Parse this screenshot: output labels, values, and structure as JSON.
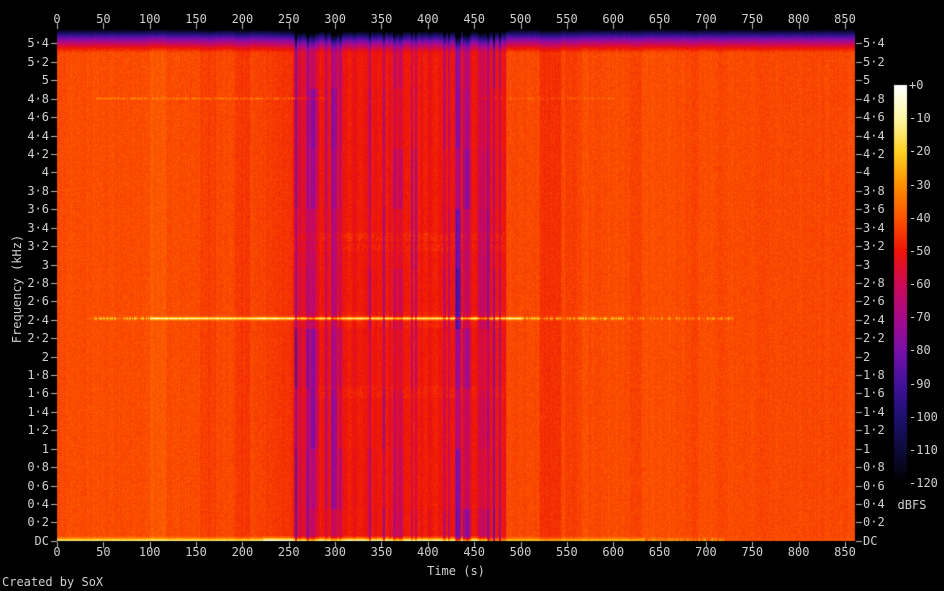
{
  "credit": "Created by SoX",
  "colors": {
    "background": "#000000",
    "label_text": "#cfcfcf",
    "tick_mark": "#b8b8b8"
  },
  "chart_data": {
    "type": "heatmap",
    "subtype": "audio-spectrogram",
    "title": "",
    "xlabel": "Time (s)",
    "ylabel": "Frequency (kHz)",
    "colorbar_label": "dBFS",
    "x_tick_labels": [
      "0",
      "50",
      "100",
      "150",
      "200",
      "250",
      "300",
      "350",
      "400",
      "450",
      "500",
      "550",
      "600",
      "650",
      "700",
      "750",
      "800",
      "850"
    ],
    "x_tick_step_s": 50,
    "freq_tick_labels": [
      "5·4",
      "5·2",
      "5",
      "4·8",
      "4·6",
      "4·4",
      "4·2",
      "4",
      "3·8",
      "3·6",
      "3·4",
      "3·2",
      "3",
      "2·8",
      "2·6",
      "2·4",
      "2·2",
      "2",
      "1·8",
      "1·6",
      "1·4",
      "1·2",
      "1",
      "0·8",
      "0·6",
      "0·4",
      "0·2",
      "DC"
    ],
    "freq_tick_step_khz": 0.2,
    "db_tick_labels": [
      "+0",
      "-10",
      "-20",
      "-30",
      "-40",
      "-50",
      "-60",
      "-70",
      "-80",
      "-90",
      "-100",
      "-110",
      "-120"
    ],
    "x_range_s": [
      0,
      860
    ],
    "y_range_khz": [
      0,
      5.5125
    ],
    "colorbar_range_dbfs": [
      0,
      -120
    ],
    "legend_position": "right",
    "grid": false,
    "palette_dbfs_stops": [
      "#000000",
      "#0d0b3a",
      "#1e1070",
      "#43119c",
      "#7a0fa8",
      "#a80a8a",
      "#cc0a55",
      "#ee1407",
      "#fc5400",
      "#ff9000",
      "#ffd224",
      "#fff7a5",
      "#ffffff"
    ],
    "features": {
      "base_level_dbfs": -41.5,
      "quiet_band": {
        "t_start_s": 255,
        "t_end_s": 483,
        "level_dbfs": -50,
        "description": "darker red band with purple/blue vertical striping between 255 s and 483 s"
      },
      "tone_line_2_4khz": {
        "freq_khz": 2.4,
        "t_start_s": 35,
        "t_strong_start_s": 100,
        "t_strong_end_s": 500,
        "t_end_s": 730,
        "peak_dbfs": -10,
        "description": "bright yellow horizontal tone line at 2.4 kHz, dashed at ends"
      },
      "tone_line_4_8khz": {
        "freq_khz": 4.8,
        "t_start_s": 42,
        "t_gap_start_s": 290,
        "t_gap_end_s": 458,
        "t_end_s": 600,
        "peak_dbfs": -33,
        "description": "faint harmonic line at 4.8 kHz"
      },
      "dc_line": {
        "freq_khz": 0,
        "peak_dbfs": -10,
        "bright_t_start_s": 222,
        "bright_t_end_s": 464,
        "fade_out_t_s": 718,
        "description": "bright yellow DC/low-frequency line along the bottom edge"
      },
      "nyquist_rolloff": {
        "above_khz": 5.3,
        "floor_dbfs": -120,
        "description": "dark blue-to-black anti-aliasing rolloff band across the top"
      }
    }
  }
}
